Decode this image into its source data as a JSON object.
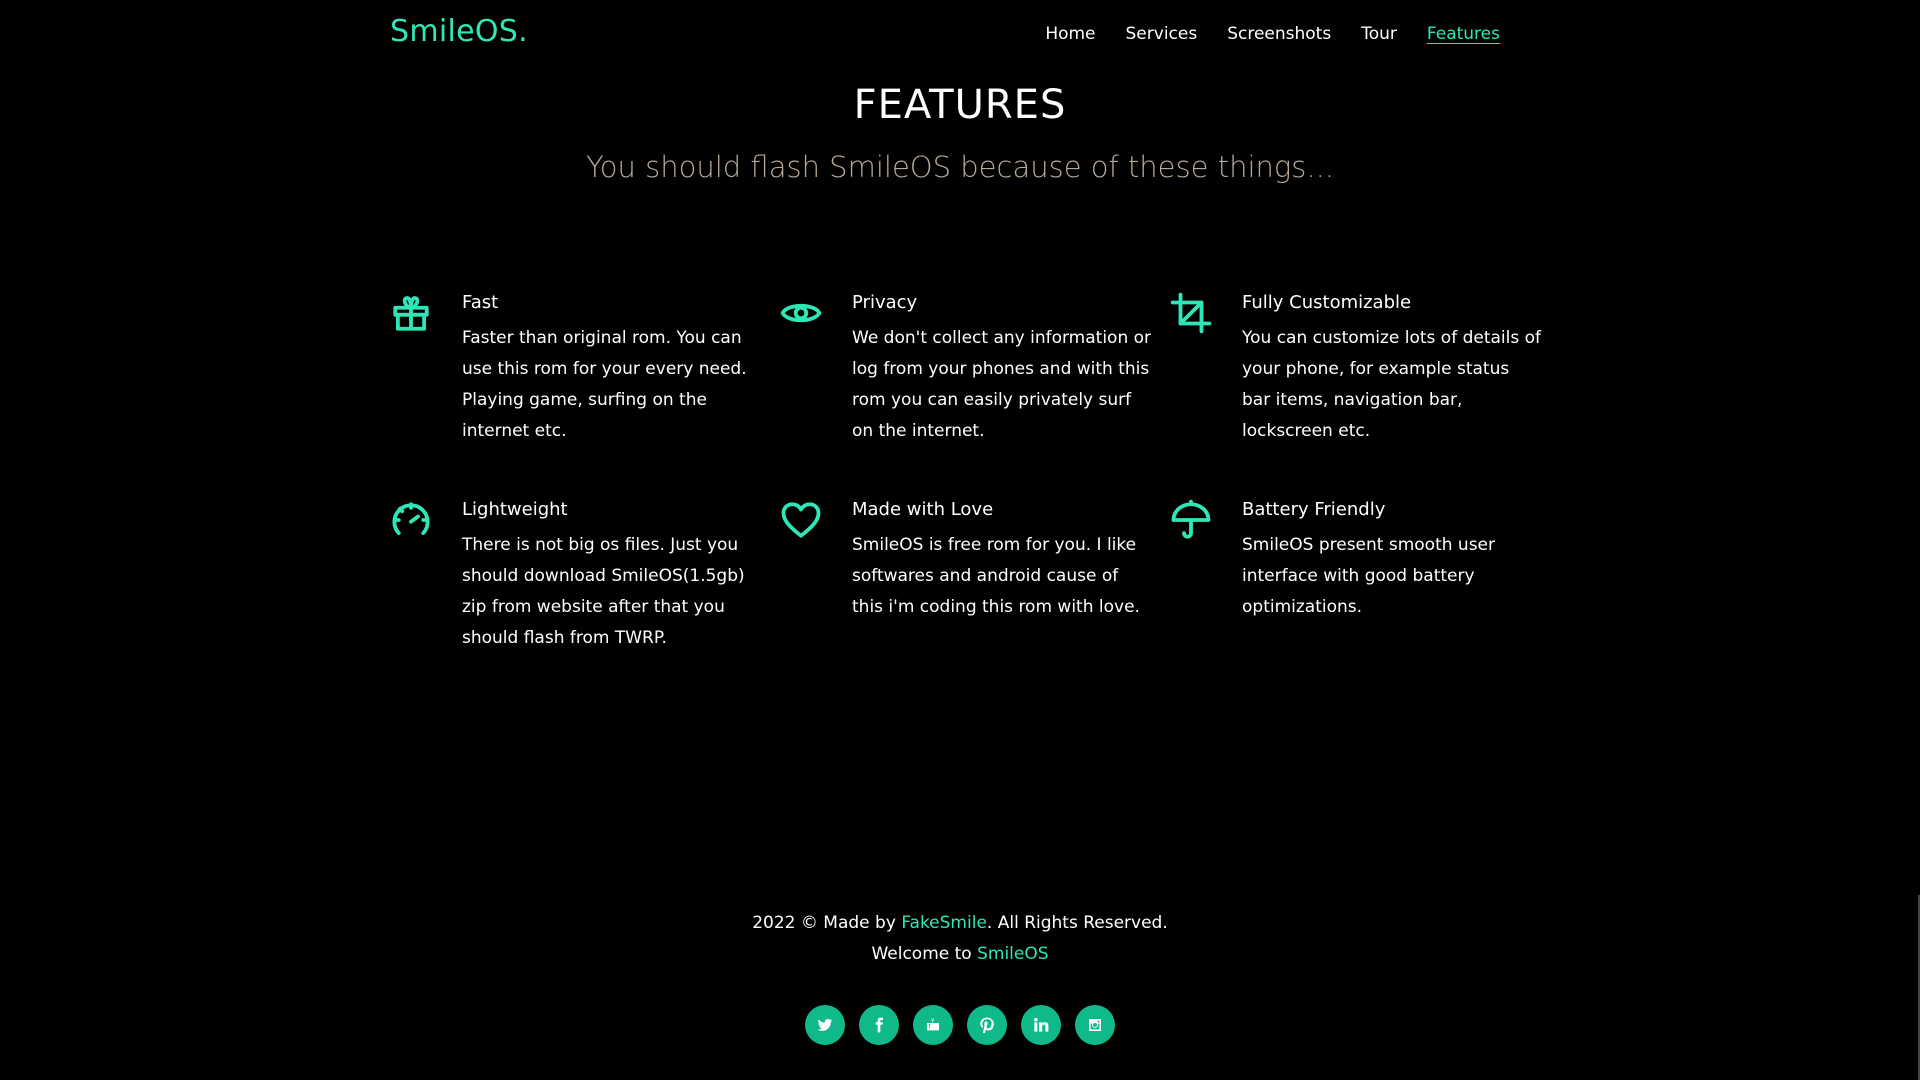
{
  "brand": "SmileOS.",
  "nav": [
    {
      "label": "Home",
      "active": false
    },
    {
      "label": "Services",
      "active": false
    },
    {
      "label": "Screenshots",
      "active": false
    },
    {
      "label": "Tour",
      "active": false
    },
    {
      "label": "Features",
      "active": true
    }
  ],
  "section": {
    "title": "FEATURES",
    "subtitle": "You should flash SmileOS because of these things..."
  },
  "features": [
    {
      "icon": "gift-icon",
      "title": "Fast",
      "text": "Faster than original rom. You can use this rom for your every need. Playing game, surfing on the internet etc."
    },
    {
      "icon": "eye-icon",
      "title": "Privacy",
      "text": "We don't collect any information or log from your phones and with this rom you can easily privately surf on the internet."
    },
    {
      "icon": "crop-icon",
      "title": "Fully Customizable",
      "text": "You can customize lots of details of your phone, for example status bar items, navigation bar, lockscreen etc."
    },
    {
      "icon": "speedometer-icon",
      "title": "Lightweight",
      "text": "There is not big os files. Just you should download SmileOS(1.5gb) zip from website after that you should flash from TWRP."
    },
    {
      "icon": "heart-icon",
      "title": "Made with Love",
      "text": "SmileOS is free rom for you. I like softwares and android cause of this i'm coding this rom with love."
    },
    {
      "icon": "umbrella-icon",
      "title": "Battery Friendly",
      "text": "SmileOS present smooth user interface with good battery optimizations."
    }
  ],
  "footer": {
    "copyright_prefix": "2022 © Made by ",
    "author": "FakeSmile",
    "copyright_suffix": ". All Rights Reserved.",
    "welcome_prefix": "Welcome to ",
    "welcome_link": "SmileOS"
  },
  "socials": [
    {
      "icon": "twitter-icon"
    },
    {
      "icon": "facebook-icon"
    },
    {
      "icon": "youtube-icon"
    },
    {
      "icon": "pinterest-icon"
    },
    {
      "icon": "linkedin-icon"
    },
    {
      "icon": "instagram-icon"
    }
  ],
  "colors": {
    "accent": "#2ee6b6",
    "social_bg": "#10b98a",
    "subtitle": "#b9aa9a",
    "background": "#000000"
  }
}
